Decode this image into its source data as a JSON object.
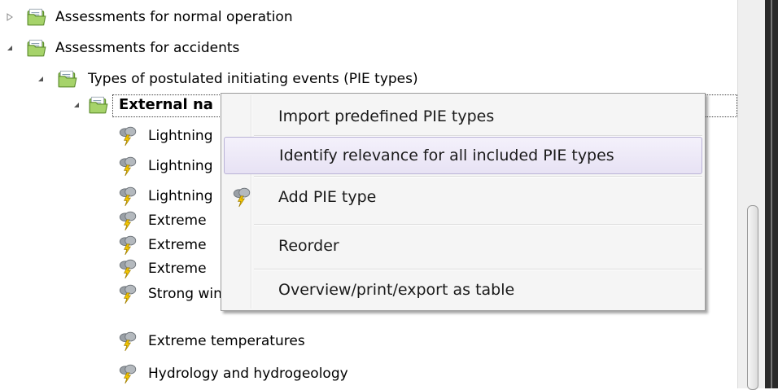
{
  "tree": {
    "nodes": [
      {
        "label": "Assessments for normal operation",
        "icon": "folder-icon",
        "expander": "collapsed"
      },
      {
        "label": "Assessments for accidents",
        "icon": "folder-icon",
        "expander": "expanded"
      },
      {
        "label": "Types of postulated initiating events (PIE types)",
        "icon": "folder-icon",
        "expander": "expanded"
      },
      {
        "label": "External na",
        "icon": "folder-icon",
        "expander": "expanded",
        "selected": true
      },
      {
        "label": "Lightning",
        "icon": "lightning-icon"
      },
      {
        "label": "Lightning",
        "icon": "lightning-icon"
      },
      {
        "label": "Lightning",
        "icon": "lightning-icon"
      },
      {
        "label": "Extreme",
        "icon": "lightning-icon"
      },
      {
        "label": "Extreme",
        "icon": "lightning-icon"
      },
      {
        "label": "Extreme",
        "icon": "lightning-icon"
      },
      {
        "label": "Strong wind",
        "icon": "lightning-icon"
      },
      {
        "label": "Extreme temperatures",
        "icon": "lightning-icon"
      },
      {
        "label": "Hydrology and hydrogeology",
        "icon": "lightning-icon"
      }
    ]
  },
  "context_menu": {
    "items": [
      {
        "label": "Import predefined PIE types"
      },
      {
        "label": "Identify relevance for all included PIE types",
        "highlighted": true
      },
      {
        "label": "Add PIE type",
        "icon": "lightning-icon"
      },
      {
        "label": "Reorder"
      },
      {
        "label": "Overview/print/export as table"
      }
    ]
  },
  "colors": {
    "menu_background": "#f5f5f5",
    "menu_highlight": "#e7e2f4",
    "folder_green": "#7fb24a"
  }
}
